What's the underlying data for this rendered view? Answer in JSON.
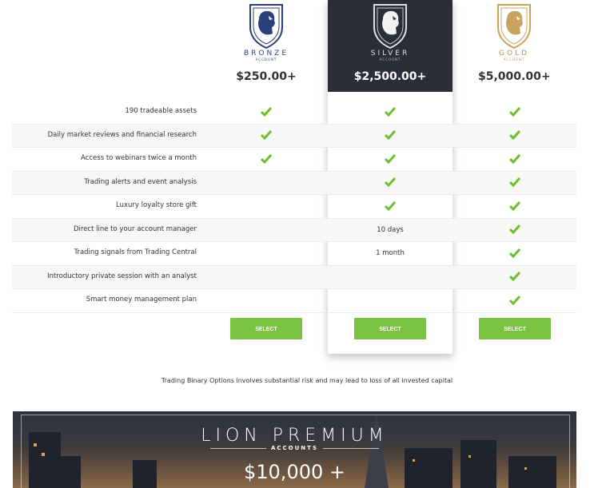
{
  "plans": [
    {
      "id": "bronze",
      "name": "BRONZE",
      "sub": "ACCOUNT",
      "price": "$250.00+",
      "select": "SELECT",
      "color": "#2c3f7a"
    },
    {
      "id": "silver",
      "name": "SILVER",
      "sub": "ACCOUNT",
      "price": "$2,500.00+",
      "select": "SELECT",
      "color": "#d0d0d0"
    },
    {
      "id": "gold",
      "name": "GOLD",
      "sub": "ACCOUNT",
      "price": "$5,000.00+",
      "select": "SELECT",
      "color": "#b8944a"
    }
  ],
  "features": [
    {
      "label": "190 tradeable assets",
      "bronze": "check",
      "silver": "check",
      "gold": "check"
    },
    {
      "label": "Daily market reviews and financial research",
      "bronze": "check",
      "silver": "check",
      "gold": "check"
    },
    {
      "label": "Access to webinars twice a month",
      "bronze": "check",
      "silver": "check",
      "gold": "check"
    },
    {
      "label": "Trading alerts and event analysis",
      "bronze": "",
      "silver": "check",
      "gold": "check"
    },
    {
      "label": "Luxury loyalty store gift",
      "bronze": "",
      "silver": "check",
      "gold": "check"
    },
    {
      "label": "Direct line to your account manager",
      "bronze": "",
      "silver": "10 days",
      "gold": "check"
    },
    {
      "label": "Trading signals from Trading Central",
      "bronze": "",
      "silver": "1 month",
      "gold": "check"
    },
    {
      "label": "Introductory private session with an analyst",
      "bronze": "",
      "silver": "",
      "gold": "check"
    },
    {
      "label": "Smart money management plan",
      "bronze": "",
      "silver": "",
      "gold": "check"
    }
  ],
  "disclaimer": "Trading Binary Options involves substantial risk and may lead to loss of all invested capital",
  "banner": {
    "title": "LION PREMIUM",
    "subtitle": "ACCOUNTS",
    "price": "$10,000 +"
  },
  "colors": {
    "check": "#6cbf2e",
    "button": "#7cc242",
    "silver_header": "#2b2e38"
  }
}
